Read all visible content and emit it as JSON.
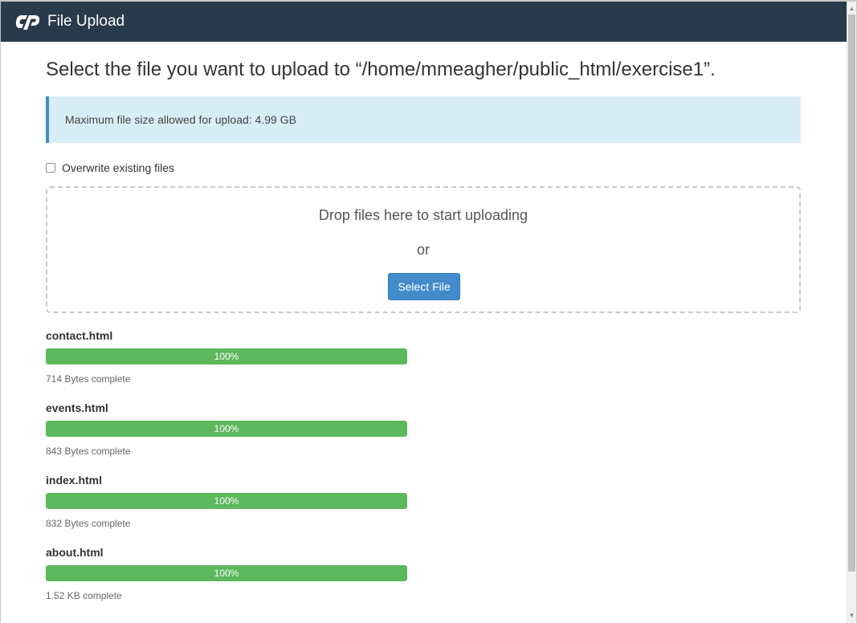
{
  "header": {
    "logo_icon": "cpanel-logo-icon",
    "title": "File Upload"
  },
  "main": {
    "heading": "Select the file you want to upload to “/home/mmeagher/public_html/exercise1”.",
    "info": "Maximum file size allowed for upload: 4.99 GB",
    "overwrite_label": "Overwrite existing files",
    "overwrite_checked": false,
    "drop_text": "Drop files here to start uploading",
    "or_text": "or",
    "select_button": "Select File"
  },
  "uploads": [
    {
      "name": "contact.html",
      "progress": 100,
      "progress_label": "100%",
      "status": "714 Bytes complete"
    },
    {
      "name": "events.html",
      "progress": 100,
      "progress_label": "100%",
      "status": "843 Bytes complete"
    },
    {
      "name": "index.html",
      "progress": 100,
      "progress_label": "100%",
      "status": "832 Bytes complete"
    },
    {
      "name": "about.html",
      "progress": 100,
      "progress_label": "100%",
      "status": "1.52 KB complete"
    }
  ],
  "colors": {
    "topbar": "#293a4a",
    "accent": "#428bca",
    "progress": "#5cb85c",
    "info_bg": "#d9edf7"
  }
}
